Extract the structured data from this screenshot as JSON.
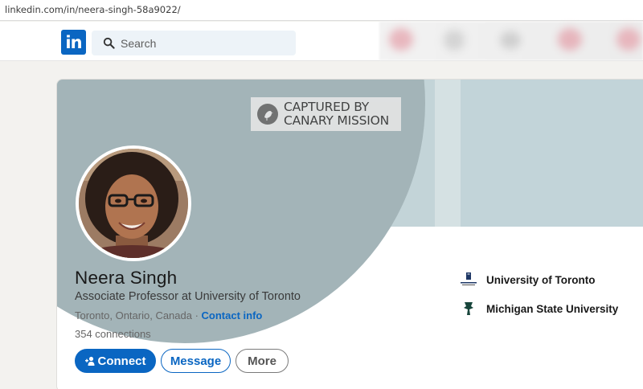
{
  "browser": {
    "url": "linkedin.com/in/neera-singh-58a9022/"
  },
  "header": {
    "logo_text": "in",
    "search_placeholder": "Search",
    "icons": [
      "linkedin-logo",
      "search-icon"
    ]
  },
  "banner": {
    "watermark_text": "CAPTURED BY\nCANARY MISSION"
  },
  "profile": {
    "name": "Neera Singh",
    "headline": "Associate Professor at University of Toronto",
    "location": "Toronto, Ontario, Canada · ",
    "contact_info": "Contact info",
    "connections": "354 connections"
  },
  "actions": {
    "connect": "Connect",
    "message": "Message",
    "more": "More"
  },
  "education": [
    {
      "name": "University of Toronto",
      "logo": "university-of-toronto-logo"
    },
    {
      "name": "Michigan State University",
      "logo": "michigan-state-logo"
    }
  ],
  "colors": {
    "primary_blue": "#0a66c2",
    "banner_bg": "#c3d4d8",
    "banner_circle": "#a3b4b8",
    "page_bg": "#f3f2ef",
    "msu_green": "#18453b"
  }
}
